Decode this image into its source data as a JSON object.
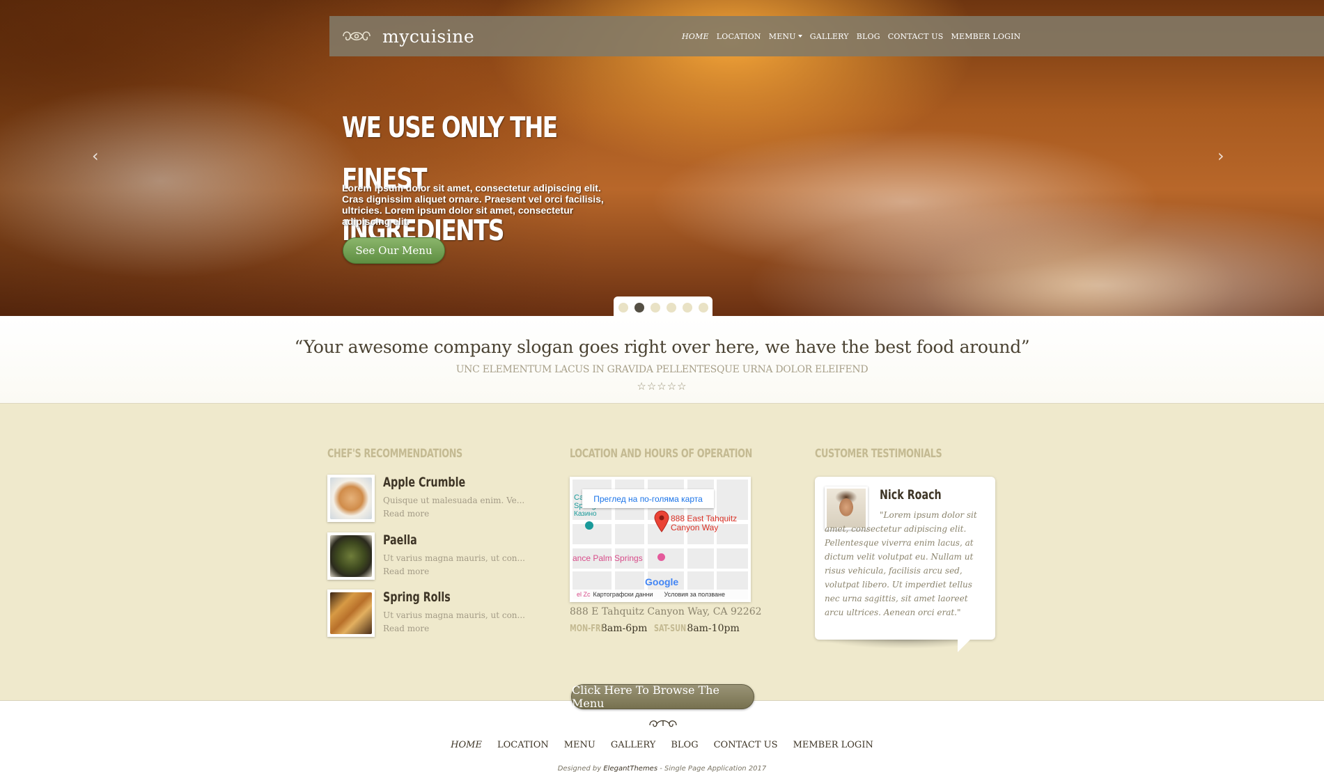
{
  "brand": {
    "name": "mycuisine",
    "logo_icon": "ornament-logo-icon"
  },
  "nav": {
    "items": [
      {
        "label": "HOME",
        "active": true
      },
      {
        "label": "LOCATION"
      },
      {
        "label": "MENU",
        "dropdown": true
      },
      {
        "label": "GALLERY"
      },
      {
        "label": "BLOG"
      },
      {
        "label": "CONTACT US"
      },
      {
        "label": "MEMBER LOGIN"
      }
    ]
  },
  "hero": {
    "title_line1": "WE USE ONLY THE FINEST",
    "title_line2": "INGREDIENTS",
    "text": "Lorem ipsum dolor sit amet, consectetur adipiscing elit. Cras dignissim aliquet ornare. Praesent vel orci facilisis, ultricies. Lorem ipsum dolor sit amet, consectetur adipiscing elit.",
    "button_label": "See Our Menu",
    "prev_arrow": "‹",
    "next_arrow": "›",
    "slide_count": 6,
    "active_slide": 2
  },
  "slogan": {
    "quote": "“Your awesome company slogan goes right over here, we have the best food around”",
    "subtitle": "UNC ELEMENTUM LACUS IN GRAVIDA PELLENTESQUE URNA DOLOR ELEIFEND",
    "stars": "☆☆☆☆☆"
  },
  "recommendations": {
    "title": "CHEF'S RECOMMENDATIONS",
    "items": [
      {
        "name": "Apple Crumble",
        "desc": "Quisque ut malesuada enim. Ve...",
        "more": "Read more"
      },
      {
        "name": "Paella",
        "desc": "Ut varius magna mauris, ut con...",
        "more": "Read more"
      },
      {
        "name": "Spring Rolls",
        "desc": "Ut varius magna mauris, ut con...",
        "more": "Read more"
      }
    ]
  },
  "location": {
    "title": "LOCATION AND HOURS OF OPERATION",
    "map": {
      "larger_map": "Преглед на по-голяма карта",
      "pin_label_1": "888 East Tahquitz",
      "pin_label_2": "Canyon Way",
      "place_1": "Ca",
      "place_2": "Springs",
      "place_3": "Казино",
      "place_4": "ance Palm Springs",
      "google": "Google",
      "footer_left": "el Zc",
      "footer_data": "Картографски данни",
      "footer_terms": "Условия за ползване"
    },
    "address": "888 E Tahquitz Canyon Way, CA 92262",
    "hours": {
      "label1": "MON-FRI",
      "time1": "8am-6pm",
      "label2": "SAT-SUN",
      "time2": "8am-10pm"
    }
  },
  "testimonials": {
    "title": "CUSTOMER TESTIMONIALS",
    "name": "Nick Roach",
    "quote": "\"Lorem ipsum dolor sit amet, consectetur adipiscing elit. Pellentesque viverra enim lacus, at dictum velit volutpat eu. Nullam ut risus vehicula, facilisis arcu sed, volutpat libero. Ut imperdiet tellus nec urna sagittis, sit amet laoreet arcu ultrices. Aenean orci erat.\""
  },
  "browse_button": "Click Here To Browse The Menu",
  "footer": {
    "nav": [
      "HOME",
      "LOCATION",
      "MENU",
      "GALLERY",
      "BLOG",
      "CONTACT US",
      "MEMBER LOGIN"
    ],
    "credits_prefix": "Designed by ",
    "credits_brand": "ElegantThemes",
    "credits_suffix": " - Single Page Application 2017"
  },
  "colors": {
    "accent_green": "#6b9a4e",
    "nav_bg": "#827a68",
    "section_bg": "#efe9cc",
    "heading_muted": "#c4ba92"
  }
}
